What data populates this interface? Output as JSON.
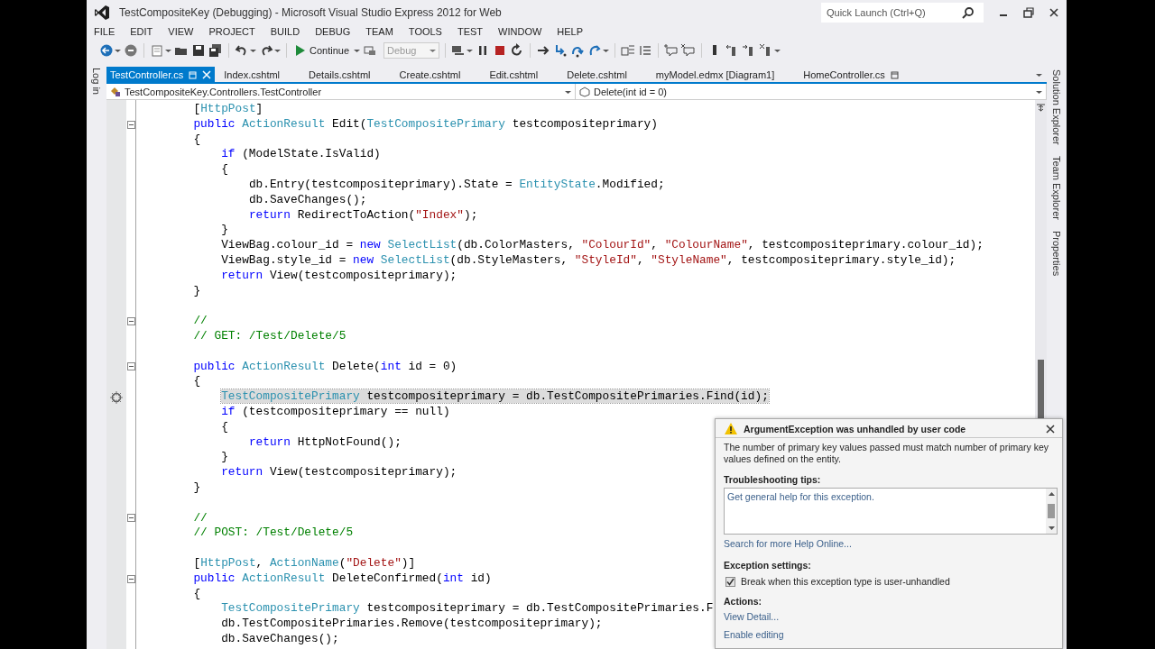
{
  "window": {
    "title": "TestCompositeKey (Debugging) - Microsoft Visual Studio Express 2012 for Web",
    "quick_launch": {
      "placeholder": "Quick Launch (Ctrl+Q)"
    }
  },
  "menu": [
    "FILE",
    "EDIT",
    "VIEW",
    "PROJECT",
    "BUILD",
    "DEBUG",
    "TEAM",
    "TOOLS",
    "TEST",
    "WINDOW",
    "HELP"
  ],
  "toolbar": {
    "continue_label": "Continue",
    "configuration": {
      "value": "Debug",
      "disabled": true
    }
  },
  "left_tabs": [
    "Log in"
  ],
  "tabs": [
    {
      "label": "TestController.cs",
      "selected": true,
      "pinned": true
    },
    {
      "label": "Index.cshtml",
      "selected": false,
      "pinned": false
    },
    {
      "label": "Details.cshtml",
      "selected": false,
      "pinned": false
    },
    {
      "label": "Create.cshtml",
      "selected": false,
      "pinned": false
    },
    {
      "label": "Edit.cshtml",
      "selected": false,
      "pinned": false
    },
    {
      "label": "Delete.cshtml",
      "selected": false,
      "pinned": false
    },
    {
      "label": "myModel.edmx [Diagram1]",
      "selected": false,
      "pinned": false
    },
    {
      "label": "HomeController.cs",
      "selected": false,
      "pinned": true
    }
  ],
  "navigation": {
    "type_dropdown": "TestCompositeKey.Controllers.TestController",
    "member_dropdown": "Delete(int id = 0)"
  },
  "code_lines": [
    {
      "fold": false,
      "current": false,
      "tokens": [
        {
          "kind": "p",
          "text": "        ["
        },
        {
          "kind": "ty",
          "text": "HttpPost"
        },
        {
          "kind": "p",
          "text": "]"
        }
      ]
    },
    {
      "fold": true,
      "current": false,
      "tokens": [
        {
          "kind": "kw",
          "text": "        public "
        },
        {
          "kind": "ty",
          "text": "ActionResult"
        },
        {
          "kind": "p",
          "text": " Edit("
        },
        {
          "kind": "ty",
          "text": "TestCompositePrimary"
        },
        {
          "kind": "p",
          "text": " testcompositeprimary)"
        }
      ]
    },
    {
      "fold": false,
      "current": false,
      "tokens": [
        {
          "kind": "p",
          "text": "        {"
        }
      ]
    },
    {
      "fold": false,
      "current": false,
      "tokens": [
        {
          "kind": "kw",
          "text": "            if"
        },
        {
          "kind": "p",
          "text": " (ModelState.IsValid)"
        }
      ]
    },
    {
      "fold": false,
      "current": false,
      "tokens": [
        {
          "kind": "p",
          "text": "            {"
        }
      ]
    },
    {
      "fold": false,
      "current": false,
      "tokens": [
        {
          "kind": "p",
          "text": "                db.Entry(testcompositeprimary).State = "
        },
        {
          "kind": "ty",
          "text": "EntityState"
        },
        {
          "kind": "p",
          "text": ".Modified;"
        }
      ]
    },
    {
      "fold": false,
      "current": false,
      "tokens": [
        {
          "kind": "p",
          "text": "                db.SaveChanges();"
        }
      ]
    },
    {
      "fold": false,
      "current": false,
      "tokens": [
        {
          "kind": "kw",
          "text": "                return"
        },
        {
          "kind": "p",
          "text": " RedirectToAction("
        },
        {
          "kind": "str",
          "text": "\"Index\""
        },
        {
          "kind": "p",
          "text": ");"
        }
      ]
    },
    {
      "fold": false,
      "current": false,
      "tokens": [
        {
          "kind": "p",
          "text": "            }"
        }
      ]
    },
    {
      "fold": false,
      "current": false,
      "tokens": [
        {
          "kind": "p",
          "text": "            ViewBag.colour_id = "
        },
        {
          "kind": "kw",
          "text": "new "
        },
        {
          "kind": "ty",
          "text": "SelectList"
        },
        {
          "kind": "p",
          "text": "(db.ColorMasters, "
        },
        {
          "kind": "str",
          "text": "\"ColourId\""
        },
        {
          "kind": "p",
          "text": ", "
        },
        {
          "kind": "str",
          "text": "\"ColourName\""
        },
        {
          "kind": "p",
          "text": ", testcompositeprimary.colour_id);"
        }
      ]
    },
    {
      "fold": false,
      "current": false,
      "tokens": [
        {
          "kind": "p",
          "text": "            ViewBag.style_id = "
        },
        {
          "kind": "kw",
          "text": "new "
        },
        {
          "kind": "ty",
          "text": "SelectList"
        },
        {
          "kind": "p",
          "text": "(db.StyleMasters, "
        },
        {
          "kind": "str",
          "text": "\"StyleId\""
        },
        {
          "kind": "p",
          "text": ", "
        },
        {
          "kind": "str",
          "text": "\"StyleName\""
        },
        {
          "kind": "p",
          "text": ", testcompositeprimary.style_id);"
        }
      ]
    },
    {
      "fold": false,
      "current": false,
      "tokens": [
        {
          "kind": "kw",
          "text": "            return"
        },
        {
          "kind": "p",
          "text": " View(testcompositeprimary);"
        }
      ]
    },
    {
      "fold": false,
      "current": false,
      "tokens": [
        {
          "kind": "p",
          "text": "        }"
        }
      ]
    },
    {
      "fold": false,
      "current": false
    },
    {
      "fold": true,
      "current": false,
      "tokens": [
        {
          "kind": "cm",
          "text": "        //"
        }
      ]
    },
    {
      "fold": false,
      "current": false,
      "tokens": [
        {
          "kind": "cm",
          "text": "        // GET: /Test/Delete/5"
        }
      ]
    },
    {
      "fold": false,
      "current": false
    },
    {
      "fold": true,
      "current": false,
      "tokens": [
        {
          "kind": "kw",
          "text": "        public "
        },
        {
          "kind": "ty",
          "text": "ActionResult"
        },
        {
          "kind": "p",
          "text": " Delete("
        },
        {
          "kind": "kw",
          "text": "int"
        },
        {
          "kind": "p",
          "text": " id = 0)"
        }
      ]
    },
    {
      "fold": false,
      "current": false,
      "tokens": [
        {
          "kind": "p",
          "text": "        {"
        }
      ]
    },
    {
      "fold": false,
      "current": true,
      "tokens": [
        {
          "kind": "ty",
          "text": "            TestCompositePrimary"
        },
        {
          "kind": "p",
          "text": " testcompositeprimary = db.TestCompositePrimaries.Find(id);"
        }
      ]
    },
    {
      "fold": false,
      "current": false,
      "tokens": [
        {
          "kind": "kw",
          "text": "            if"
        },
        {
          "kind": "p",
          "text": " (testcompositeprimary == null)"
        }
      ]
    },
    {
      "fold": false,
      "current": false,
      "tokens": [
        {
          "kind": "p",
          "text": "            {"
        }
      ]
    },
    {
      "fold": false,
      "current": false,
      "tokens": [
        {
          "kind": "kw",
          "text": "                return"
        },
        {
          "kind": "p",
          "text": " HttpNotFound();"
        }
      ]
    },
    {
      "fold": false,
      "current": false,
      "tokens": [
        {
          "kind": "p",
          "text": "            }"
        }
      ]
    },
    {
      "fold": false,
      "current": false,
      "tokens": [
        {
          "kind": "kw",
          "text": "            return"
        },
        {
          "kind": "p",
          "text": " View(testcompositeprimary);"
        }
      ]
    },
    {
      "fold": false,
      "current": false,
      "tokens": [
        {
          "kind": "p",
          "text": "        }"
        }
      ]
    },
    {
      "fold": false,
      "current": false
    },
    {
      "fold": true,
      "current": false,
      "tokens": [
        {
          "kind": "cm",
          "text": "        //"
        }
      ]
    },
    {
      "fold": false,
      "current": false,
      "tokens": [
        {
          "kind": "cm",
          "text": "        // POST: /Test/Delete/5"
        }
      ]
    },
    {
      "fold": false,
      "current": false
    },
    {
      "fold": false,
      "current": false,
      "tokens": [
        {
          "kind": "p",
          "text": "        ["
        },
        {
          "kind": "ty",
          "text": "HttpPost"
        },
        {
          "kind": "p",
          "text": ", "
        },
        {
          "kind": "ty",
          "text": "ActionName"
        },
        {
          "kind": "p",
          "text": "("
        },
        {
          "kind": "str",
          "text": "\"Delete\""
        },
        {
          "kind": "p",
          "text": ")]"
        }
      ]
    },
    {
      "fold": true,
      "current": false,
      "tokens": [
        {
          "kind": "kw",
          "text": "        public "
        },
        {
          "kind": "ty",
          "text": "ActionResult"
        },
        {
          "kind": "p",
          "text": " DeleteConfirmed("
        },
        {
          "kind": "kw",
          "text": "int"
        },
        {
          "kind": "p",
          "text": " id)"
        }
      ]
    },
    {
      "fold": false,
      "current": false,
      "tokens": [
        {
          "kind": "p",
          "text": "        {"
        }
      ]
    },
    {
      "fold": false,
      "current": false,
      "tokens": [
        {
          "kind": "ty",
          "text": "            TestCompositePrimary"
        },
        {
          "kind": "p",
          "text": " testcompositeprimary = db.TestCompositePrimaries.F"
        }
      ]
    },
    {
      "fold": false,
      "current": false,
      "tokens": [
        {
          "kind": "p",
          "text": "            db.TestCompositePrimaries.Remove(testcompositeprimary);"
        }
      ]
    },
    {
      "fold": false,
      "current": false,
      "tokens": [
        {
          "kind": "p",
          "text": "            db.SaveChanges();"
        }
      ]
    }
  ],
  "right_tabs": [
    "Solution Explorer",
    "Team Explorer",
    "Properties"
  ],
  "exception_popup": {
    "title": "ArgumentException was unhandled by user code",
    "message": "The number of primary key values passed must match number of primary key values defined on the entity.",
    "tips_heading": "Troubleshooting tips:",
    "tips": [
      "Get general help for this exception."
    ],
    "help_link": "Search for more Help Online...",
    "settings_heading": "Exception settings:",
    "break_option": {
      "label": "Break when this exception type is user-unhandled",
      "checked": true
    },
    "actions_heading": "Actions:",
    "actions": [
      "View Detail...",
      "Enable editing"
    ]
  }
}
